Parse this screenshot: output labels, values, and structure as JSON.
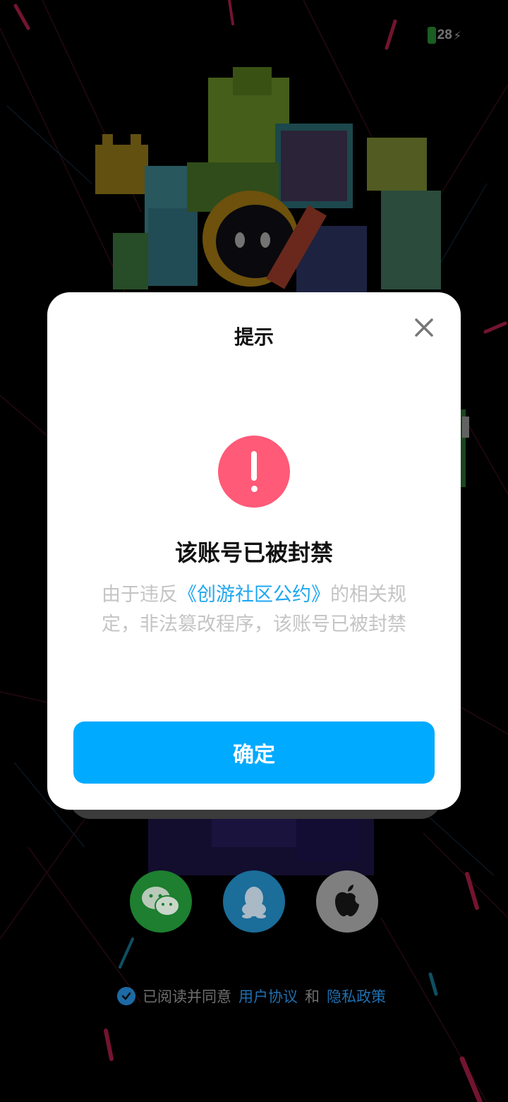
{
  "status": {
    "battery": "28"
  },
  "dialog": {
    "title": "提示",
    "heading": "该账号已被封禁",
    "message_pre": "由于违反",
    "message_link": "《创游社区公约》",
    "message_post": "的相关规定，非法篡改程序，该账号已被封禁",
    "confirm_label": "确定"
  },
  "login": {
    "buttons": [
      "wechat",
      "qq",
      "apple"
    ]
  },
  "agreement": {
    "prefix": "已阅读并同意",
    "user_agreement": "用户协议",
    "and": "和",
    "privacy_policy": "隐私政策"
  },
  "colors": {
    "accent": "#00aaff",
    "alert": "#ff5a78",
    "link": "#1ea7f2"
  }
}
